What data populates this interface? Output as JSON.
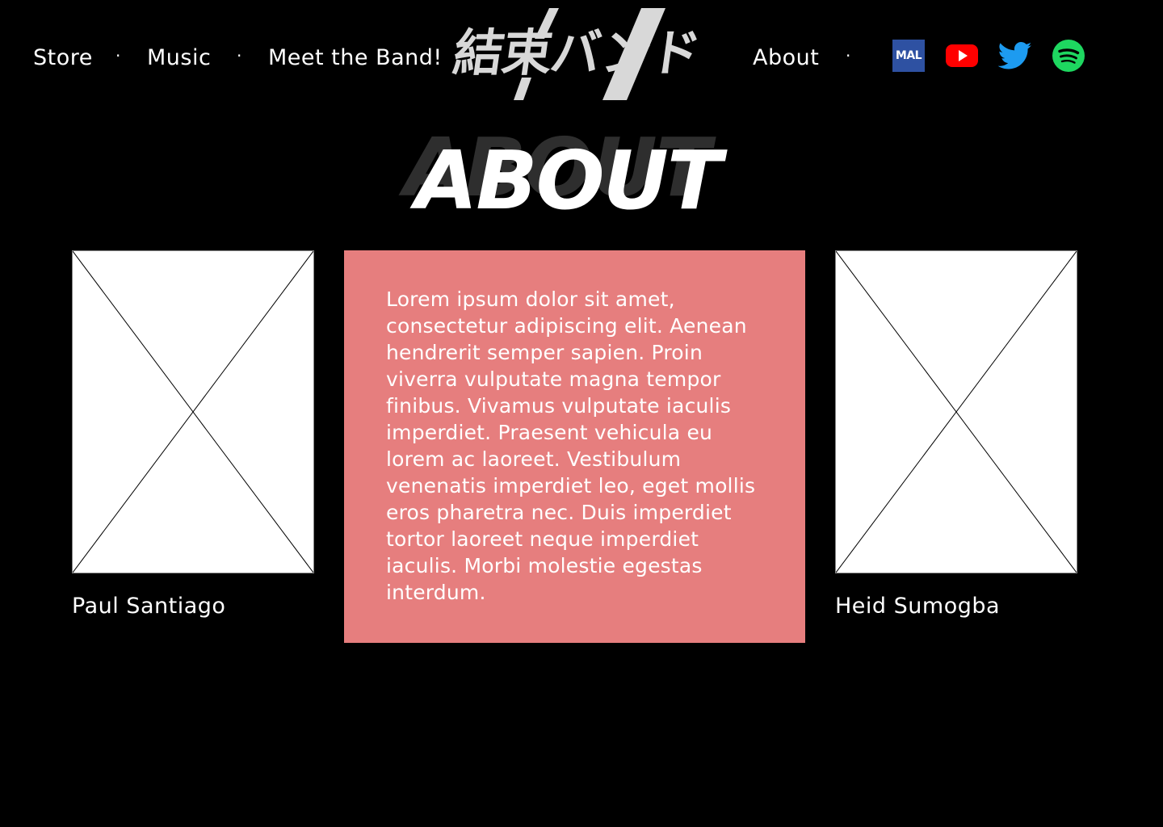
{
  "nav": {
    "left_links": [
      "Store",
      "Music",
      "Meet the Band!"
    ],
    "right_links": [
      "About"
    ],
    "separator": "·"
  },
  "logo": {
    "text": "結束バンド"
  },
  "social": {
    "mal_label": "MAL",
    "items": [
      {
        "name": "myanimelist-icon",
        "color": "#2e51a2"
      },
      {
        "name": "youtube-icon",
        "color": "#ff0000"
      },
      {
        "name": "twitter-icon",
        "color": "#1d9bf0"
      },
      {
        "name": "spotify-icon",
        "color": "#1ed760"
      }
    ]
  },
  "heading": {
    "title": "ABOUT",
    "shadow_title": "ABOUT"
  },
  "members": [
    {
      "name": "Paul Santiago"
    },
    {
      "name": "Heid Sumogba"
    }
  ],
  "about": {
    "text": "Lorem ipsum dolor sit amet, consectetur adipiscing elit. Aenean hendrerit semper sapien. Proin viverra vulputate magna tempor finibus. Vivamus vulputate iaculis imperdiet. Praesent vehicula eu lorem ac laoreet. Vestibulum venenatis imperdiet leo, eget mollis eros pharetra nec. Duis imperdiet tortor laoreet neque imperdiet iaculis. Morbi molestie egestas interdum.",
    "background": "#e67e7e"
  },
  "colors": {
    "background": "#000000",
    "text": "#ffffff",
    "logo": "#d8d8d8",
    "heading_shadow": "#2e2e2e"
  }
}
